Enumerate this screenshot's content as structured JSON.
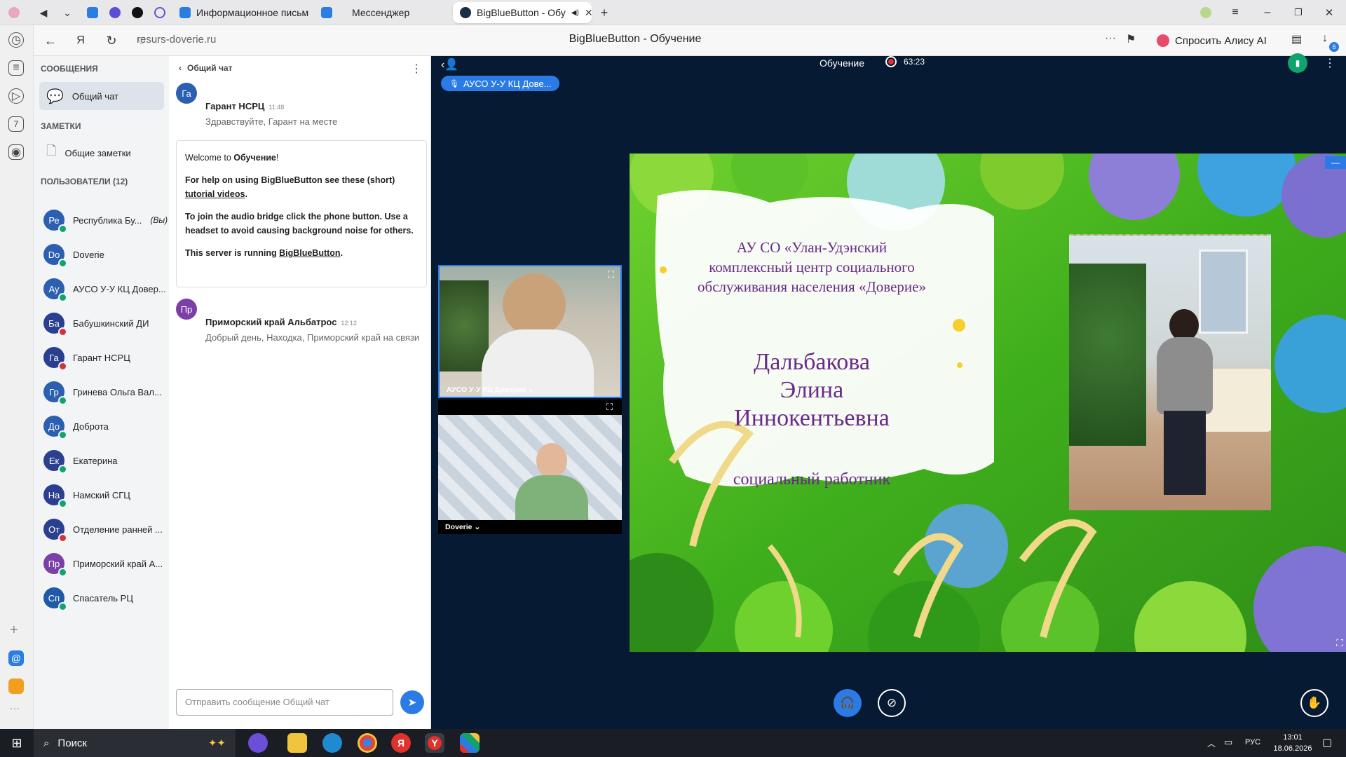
{
  "browser": {
    "tabs": [
      {
        "label": "Информационное письм"
      },
      {
        "label": "Мессенджер"
      },
      {
        "label": "BigBlueButton - Обу"
      }
    ],
    "url": "resurs-doverie.ru",
    "page_title": "BigBlueButton - Обучение",
    "alice_label": "Спросить Алису AI",
    "download_badge": "6"
  },
  "sidebar": {
    "messages_heading": "СООБЩЕНИЯ",
    "public_chat_label": "Общий чат",
    "notes_heading": "ЗАМЕТКИ",
    "shared_notes_label": "Общие заметки",
    "users_heading": "ПОЛЬЗОВАТЕЛИ (12)",
    "users": [
      {
        "initials": "Ре",
        "name": "Республика Бу...",
        "suffix": "(Вы)",
        "mic": "on",
        "color": "#2c5fb0"
      },
      {
        "initials": "Do",
        "name": "Doverie",
        "suffix": "",
        "mic": "on",
        "color": "#2c5fb0"
      },
      {
        "initials": "Ау",
        "name": "АУСО У-У КЦ Довер...",
        "suffix": "",
        "mic": "on",
        "color": "#2c5fb0"
      },
      {
        "initials": "Ба",
        "name": "Бабушкинский ДИ",
        "suffix": "",
        "mic": "off",
        "color": "#2a3f8f"
      },
      {
        "initials": "Га",
        "name": "Гарант НСРЦ",
        "suffix": "",
        "mic": "off",
        "color": "#2a3f8f"
      },
      {
        "initials": "Гр",
        "name": "Гринева Ольга Вал...",
        "suffix": "",
        "mic": "on",
        "color": "#2c5fb0"
      },
      {
        "initials": "До",
        "name": "Доброта",
        "suffix": "",
        "mic": "on",
        "color": "#2c5fb0"
      },
      {
        "initials": "Ек",
        "name": "Екатерина",
        "suffix": "",
        "mic": "on",
        "color": "#2a3f8f"
      },
      {
        "initials": "На",
        "name": "Намский СГЦ",
        "suffix": "",
        "mic": "on",
        "color": "#2a3f8f"
      },
      {
        "initials": "От",
        "name": "Отделение ранней ...",
        "suffix": "",
        "mic": "off",
        "color": "#2a3f8f"
      },
      {
        "initials": "Пр",
        "name": "Приморский край А...",
        "suffix": "",
        "mic": "on",
        "color": "#7b3fa8"
      },
      {
        "initials": "Сп",
        "name": "Спасатель РЦ",
        "suffix": "",
        "mic": "on",
        "color": "#1f5aa8"
      }
    ]
  },
  "chat": {
    "header": "Общий чат",
    "messages": [
      {
        "initials": "Га",
        "name": "Гарант НСРЦ",
        "time": "11:48",
        "text": "Здравствуйте, Гарант на месте",
        "color": "#2a3f8f"
      },
      {
        "initials": "Пр",
        "name": "Приморский край Альбатрос",
        "time": "12:12",
        "text": "Добрый день, Находка, Приморский край на связи",
        "color": "#7b3fa8"
      }
    ],
    "welcome": {
      "line1_pre": "Welcome to ",
      "line1_bold": "Обучение",
      "line1_post": "!",
      "line2_pre": "For help on using BigBlueButton see these (short) ",
      "line2_link": "tutorial videos",
      "line2_post": ".",
      "line3": "To join the audio bridge click the phone button. Use a headset to avoid causing background noise for others.",
      "line4_pre": "This server is running ",
      "line4_link": "BigBlueButton",
      "line4_post": "."
    },
    "input_placeholder": "Отправить сообщение Общий чат"
  },
  "meeting": {
    "title": "Обучение",
    "recording_time": "63:23",
    "talking_indicator": "АУСО У-У КЦ Дове...",
    "video_tiles": [
      {
        "label": "АУСО У-У КЦ Доверие"
      },
      {
        "label": "Doverie"
      }
    ]
  },
  "slide": {
    "org_line1": "АУ СО «Улан-Удэнский",
    "org_line2": "комплексный центр социального",
    "org_line3": "обслуживания населения «Доверие»",
    "name_line1": "Дальбакова",
    "name_line2": "Элина",
    "name_line3": "Иннокентьевна",
    "position": "социальный работник"
  },
  "taskbar": {
    "search_label": "Поиск",
    "lang": "РУС",
    "time": "13:01",
    "date": "18.06.2026"
  }
}
